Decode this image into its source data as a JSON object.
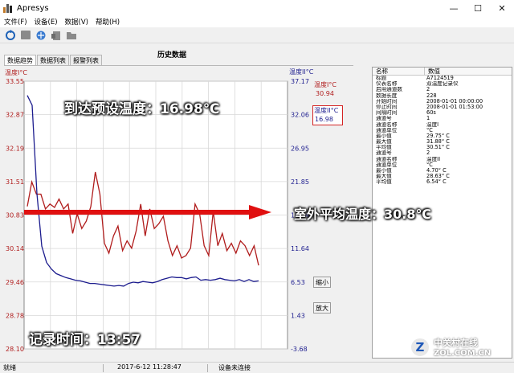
{
  "window": {
    "title": "Apresys",
    "min_glyph": "—",
    "max_glyph": "☐",
    "close_glyph": "✕"
  },
  "menu": [
    "文件(F)",
    "设备(E)",
    "数据(V)",
    "帮助(H)"
  ],
  "toolbar_icons": [
    "refresh-icon",
    "stop-icon",
    "connect-icon",
    "export-icon",
    "folder-icon"
  ],
  "panel": {
    "title": "历史数据",
    "tabs": [
      "数据趋势",
      "数据列表",
      "报警列表"
    ]
  },
  "chart": {
    "left_axis_title": "温度I°C",
    "right_axis_title": "温度II°C",
    "left_ticks": [
      "33.55",
      "32.87",
      "32.19",
      "31.51",
      "30.83",
      "30.14",
      "29.46",
      "28.78",
      "28.10"
    ],
    "right_ticks": [
      "37.17",
      "32.06",
      "26.95",
      "21.85",
      "16.74",
      "11.64",
      "6.53",
      "1.43",
      "-3.68"
    ],
    "legend": {
      "t1_label": "温度I°C",
      "t1_value": "30.94",
      "t2_label": "温度II°C",
      "t2_value": "16.98"
    },
    "zoom_out": "缩小",
    "zoom_in": "放大",
    "colors": {
      "series1": "#b01c1c",
      "series2": "#1c1c8e",
      "arrow": "#e01010"
    }
  },
  "chart_data": {
    "type": "line",
    "y_range_left": [
      28.1,
      33.55
    ],
    "y_range_right": [
      -3.68,
      37.17
    ],
    "series": [
      {
        "name": "温度I°C",
        "axis": "left",
        "values": [
          31.0,
          31.5,
          31.25,
          31.25,
          30.95,
          31.05,
          30.98,
          31.15,
          30.95,
          31.05,
          30.45,
          30.85,
          30.55,
          30.7,
          31.0,
          31.7,
          31.25,
          30.25,
          30.05,
          30.4,
          30.6,
          30.1,
          30.3,
          30.15,
          30.5,
          31.05,
          30.4,
          30.95,
          30.55,
          30.65,
          30.8,
          30.3,
          30.0,
          30.2,
          29.95,
          30.0,
          30.15,
          31.05,
          30.85,
          30.2,
          30.0,
          30.9,
          30.2,
          30.45,
          30.1,
          30.25,
          30.05,
          30.3,
          30.2,
          30.0,
          30.2,
          29.8
        ]
      },
      {
        "name": "温度II°C",
        "axis": "right",
        "values": [
          35.0,
          33.5,
          20.0,
          12.0,
          9.5,
          8.5,
          7.8,
          7.5,
          7.2,
          7.0,
          6.8,
          6.7,
          6.5,
          6.3,
          6.3,
          6.2,
          6.1,
          6.0,
          5.9,
          6.0,
          5.9,
          6.3,
          6.5,
          6.4,
          6.6,
          6.5,
          6.4,
          6.6,
          6.9,
          7.1,
          7.3,
          7.2,
          7.2,
          7.0,
          7.2,
          7.3,
          6.8,
          6.9,
          6.8,
          6.9,
          7.1,
          6.9,
          6.8,
          6.7,
          6.9,
          6.6,
          6.9,
          6.6,
          6.7
        ]
      }
    ],
    "grid": true
  },
  "info": {
    "header": [
      "名称",
      "数值"
    ],
    "rows": [
      [
        "标题",
        "A7124519"
      ],
      [
        "仪表名称",
        "双温度记录仪"
      ],
      [
        "启用通道数",
        "2"
      ],
      [
        "数据长度",
        "228"
      ],
      [
        "开始时间",
        "2008-01-01 00:00:00"
      ],
      [
        "停止时间",
        "2008-01-01 01:53:00"
      ],
      [
        "间隔时间",
        "60s"
      ],
      [
        "通道号",
        "1"
      ],
      [
        "通道名称",
        "温度I"
      ],
      [
        "通道单位",
        "°C"
      ],
      [
        "最小值",
        "29.75° C"
      ],
      [
        "最大值",
        "31.88° C"
      ],
      [
        "平均值",
        "30.51° C"
      ],
      [
        "通道号",
        "2"
      ],
      [
        "通道名称",
        "温度II"
      ],
      [
        "通道单位",
        "°C"
      ],
      [
        "最小值",
        "4.70° C"
      ],
      [
        "最大值",
        "28.63° C"
      ],
      [
        "平均值",
        "6.54° C"
      ]
    ]
  },
  "status": {
    "ready": "就绪",
    "datetime": "2017-6-12 11:28:47",
    "device": "设备未连接"
  },
  "overlays": {
    "arrive_temp": "到达预设温度：16.98℃",
    "outdoor_avg": "室外平均温度：30.8℃",
    "record_time": "记录时间：13:57"
  },
  "watermark": {
    "badge": "Z",
    "cn": "中关村在线",
    "en": "ZOL.COM.CN"
  }
}
